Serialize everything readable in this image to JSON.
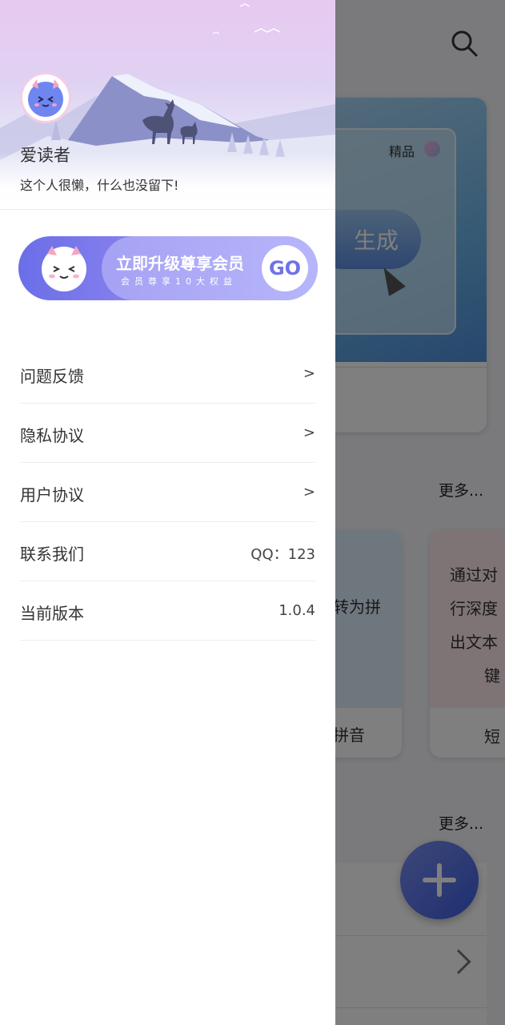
{
  "drawer": {
    "username": "爱读者",
    "bio": "这个人很懒，什么也没留下!",
    "vip": {
      "title": "立即升级尊享会员",
      "subtitle": "会员尊享10大权益",
      "go_label": "GO"
    },
    "menu": [
      {
        "label": "问题反馈",
        "value": ">"
      },
      {
        "label": "隐私协议",
        "value": ">"
      },
      {
        "label": "用户协议",
        "value": ">"
      },
      {
        "label": "联系我们",
        "value": "QQ：123"
      },
      {
        "label": "当前版本",
        "value": "1.0.4"
      }
    ]
  },
  "background": {
    "card_tag": "精品",
    "generate_label": "生成",
    "more_label_1": "更多...",
    "more_label_2": "更多...",
    "mid_card_text": "转为拼",
    "mid_card_footer": "拼音",
    "right_card_lines": [
      "通过对",
      "行深度",
      "出文本",
      "键"
    ],
    "right_card_footer": "短"
  },
  "colors": {
    "accent": "#6b6ee8",
    "fab": "#3c5ee0",
    "scrim": "rgba(0,0,0,0.5)"
  }
}
